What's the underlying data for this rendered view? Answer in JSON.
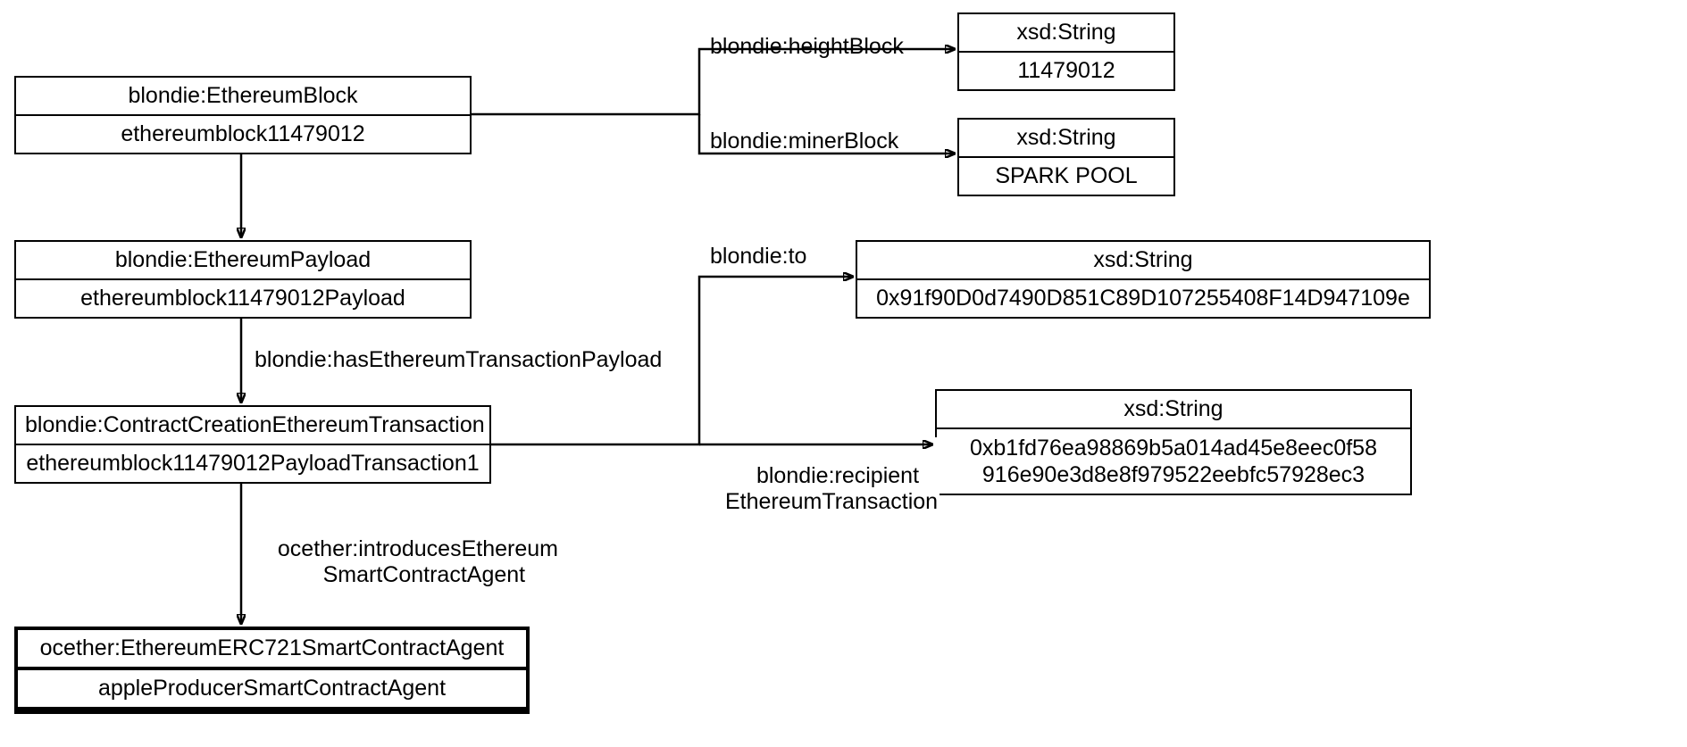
{
  "nodes": {
    "ethBlock": {
      "type": "blondie:EthereumBlock",
      "instance": "ethereumblock11479012"
    },
    "heightBlock": {
      "type": "xsd:String",
      "value": "11479012"
    },
    "minerBlock": {
      "type": "xsd:String",
      "value": "SPARK POOL"
    },
    "ethPayload": {
      "type": "blondie:EthereumPayload",
      "instance": "ethereumblock11479012Payload"
    },
    "tx": {
      "type": "blondie:ContractCreationEthereumTransaction",
      "instance": "ethereumblock11479012PayloadTransaction1"
    },
    "to": {
      "type": "xsd:String",
      "value": "0x91f90D0d7490D851C89D107255408F14D947109e"
    },
    "recipient": {
      "type": "xsd:String",
      "value1": "0xb1fd76ea98869b5a014ad45e8eec0f58",
      "value2": "916e90e3d8e8f979522eebfc57928ec3"
    },
    "agent": {
      "type": "ocether:EthereumERC721SmartContractAgent",
      "instance": "appleProducerSmartContractAgent"
    }
  },
  "edges": {
    "heightBlock": "blondie:heightBlock",
    "minerBlock": "blondie:minerBlock",
    "hasPayload": "blondie:hasEthereumTransactionPayload",
    "to": "blondie:to",
    "recipientL1": "blondie:recipient",
    "recipientL2": "EthereumTransaction",
    "introducesL1": "ocether:introducesEthereum",
    "introducesL2": "SmartContractAgent"
  }
}
